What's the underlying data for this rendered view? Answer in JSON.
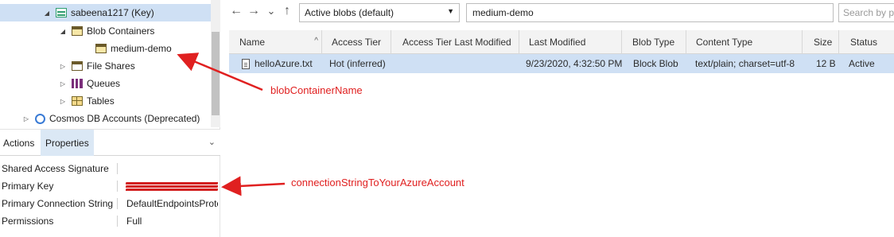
{
  "tree": {
    "items": [
      {
        "label": "sabeena1217 (Key)",
        "caret": "◢",
        "icon": "storage-account-icon"
      },
      {
        "label": "Blob Containers",
        "caret": "◢",
        "icon": "blob-containers-icon"
      },
      {
        "label": "medium-demo",
        "caret": "",
        "icon": "blob-container-icon"
      },
      {
        "label": "File Shares",
        "caret": "▷",
        "icon": "file-shares-icon"
      },
      {
        "label": "Queues",
        "caret": "▷",
        "icon": "queues-icon"
      },
      {
        "label": "Tables",
        "caret": "▷",
        "icon": "tables-icon"
      },
      {
        "label": "Cosmos DB Accounts (Deprecated)",
        "caret": "▷",
        "icon": "cosmos-db-icon"
      }
    ]
  },
  "tabs": {
    "actions": "Actions",
    "properties": "Properties",
    "chevron": "⌄"
  },
  "properties": {
    "rows": [
      {
        "name": "Shared Access Signature",
        "value": ""
      },
      {
        "name": "Primary Key",
        "value": ""
      },
      {
        "name": "Primary Connection String",
        "value": "DefaultEndpointsProto"
      },
      {
        "name": "Permissions",
        "value": "Full"
      }
    ]
  },
  "toolbar": {
    "back": "←",
    "forward": "→",
    "dropdown": "⌄",
    "up": "↑",
    "view_select": "Active blobs (default)",
    "select_arrow": "▼",
    "path": "medium-demo",
    "search_placeholder": "Search by pr"
  },
  "grid": {
    "columns": [
      "Name",
      "Access Tier",
      "Access Tier Last Modified",
      "Last Modified",
      "Blob Type",
      "Content Type",
      "Size",
      "Status"
    ],
    "sort_indicator": "^",
    "rows": [
      {
        "name": "helloAzure.txt",
        "access_tier": "Hot (inferred)",
        "access_tier_last_modified": "",
        "last_modified": "9/23/2020, 4:32:50 PM",
        "blob_type": "Block Blob",
        "content_type": "text/plain; charset=utf-8",
        "size": "12 B",
        "status": "Active"
      }
    ]
  },
  "annotations": {
    "blob_container": "blobContainerName",
    "connection_string": "connectionStringToYourAzureAccount",
    "color": "#e02020"
  },
  "colors": {
    "selection": "#cfe0f4",
    "tab_active": "#dbe8f5",
    "header_bg": "#f3f3f3"
  }
}
